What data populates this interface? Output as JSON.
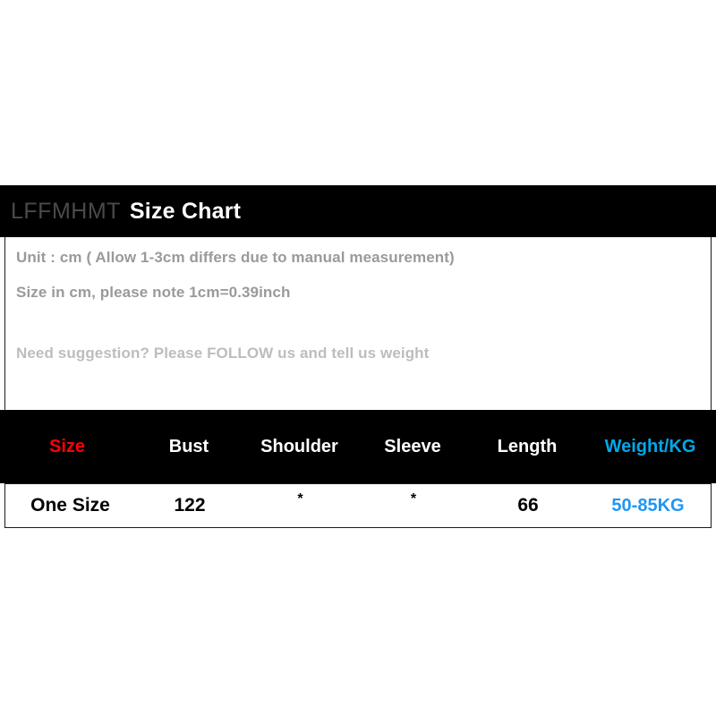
{
  "header": {
    "brand": "LFFMHMT",
    "title": "Size Chart"
  },
  "info": {
    "line1": "Unit : cm ( Allow 1-3cm differs due to manual measurement)",
    "line2": "Size in cm, please note 1cm=0.39inch",
    "line3": "Need suggestion? Please FOLLOW us and tell us weight"
  },
  "table": {
    "columns": [
      {
        "label": "Size",
        "color": "#ff0000"
      },
      {
        "label": "Bust",
        "color": "#ffffff"
      },
      {
        "label": "Shoulder",
        "color": "#ffffff"
      },
      {
        "label": "Sleeve",
        "color": "#ffffff"
      },
      {
        "label": "Length",
        "color": "#ffffff"
      },
      {
        "label": "Weight/KG",
        "color": "#00a8e8"
      }
    ],
    "rows": [
      {
        "size": "One Size",
        "bust": "122",
        "shoulder": "*",
        "sleeve": "*",
        "length": "66",
        "weight": "50-85KG"
      }
    ]
  },
  "colors": {
    "band_background": "#000000",
    "panel_background": "#ffffff",
    "brand_text": "#4a4a4a",
    "title_text": "#ffffff",
    "info_text": "#9a9a9a",
    "info_text_faded": "#bdbdbd",
    "accent_red": "#ff0000",
    "accent_cyan": "#00a8e8",
    "accent_blue": "#2196f3"
  }
}
